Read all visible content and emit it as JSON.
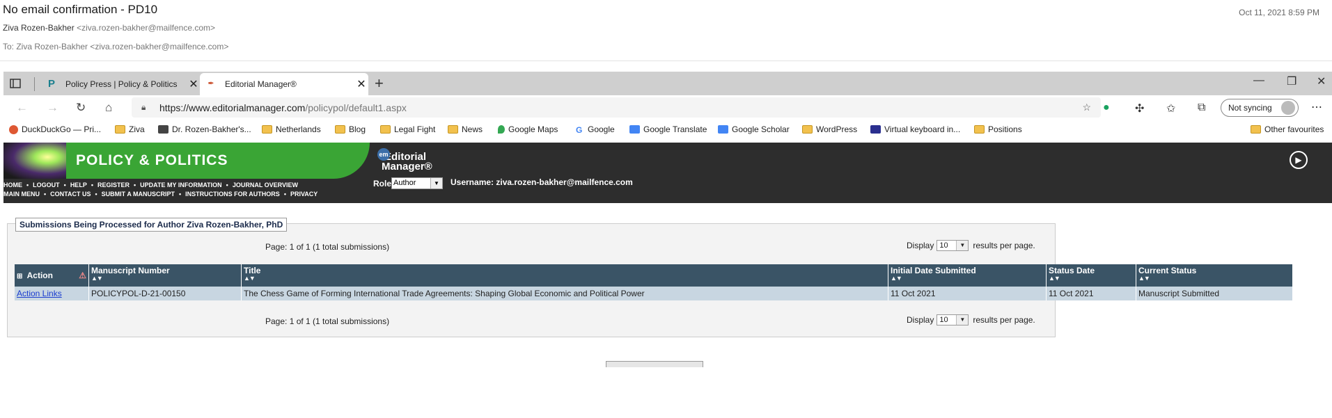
{
  "email": {
    "subject": "No email confirmation - PD10",
    "date": "Oct 11, 2021 8:59 PM",
    "from_name": "Ziva Rozen-Bakher",
    "from_addr": "<ziva.rozen-bakher@mailfence.com>",
    "to": "To: Ziva Rozen-Bakher <ziva.rozen-bakher@mailfence.com>"
  },
  "browser": {
    "tabs": [
      {
        "label": "Policy Press | Policy & Politics",
        "icon": "P"
      },
      {
        "label": "Editorial Manager®",
        "icon": "EM"
      }
    ],
    "url_host": "https://www.editorialmanager.com",
    "url_path": "/policypol/default1.aspx",
    "sync_label": "Not syncing",
    "bookmarks": [
      "DuckDuckGo — Pri...",
      "Ziva",
      "Dr. Rozen-Bakher's...",
      "Netherlands",
      "Blog",
      "Legal Fight",
      "News",
      "Google Maps",
      "Google",
      "Google Translate",
      "Google Scholar",
      "WordPress",
      "Virtual keyboard in...",
      "Positions"
    ],
    "other_favourites": "Other favourites"
  },
  "em": {
    "journal_title": "POLICY & POLITICS",
    "logo_line1": "Editorial",
    "logo_line2": "Manager®",
    "nav_row1": [
      "HOME",
      "LOGOUT",
      "HELP",
      "REGISTER",
      "UPDATE MY INFORMATION",
      "JOURNAL OVERVIEW"
    ],
    "nav_row2": [
      "MAIN MENU",
      "CONTACT US",
      "SUBMIT A MANUSCRIPT",
      "INSTRUCTIONS FOR AUTHORS",
      "PRIVACY"
    ],
    "role_label": "Role:",
    "role_value": "Author",
    "username": "Username: ziva.rozen-bakher@mailfence.com"
  },
  "submissions": {
    "panel_title": "Submissions Being Processed for Author Ziva Rozen-Bakher, PhD",
    "pager": "Page: 1 of 1 (1 total submissions)",
    "display_label": "Display",
    "display_value": "10",
    "results_label": "results per page.",
    "columns": [
      "Action",
      "Manuscript Number",
      "Title",
      "Initial Date Submitted",
      "Status Date",
      "Current Status"
    ],
    "rows": [
      {
        "action": "Action Links",
        "manuscript": "POLICYPOL-D-21-00150",
        "title": "The Chess Game of Forming International Trade Agreements: Shaping Global Economic and Political Power",
        "initial_date": "11 Oct 2021",
        "status_date": "11 Oct 2021",
        "status": "Manuscript Submitted"
      }
    ]
  }
}
